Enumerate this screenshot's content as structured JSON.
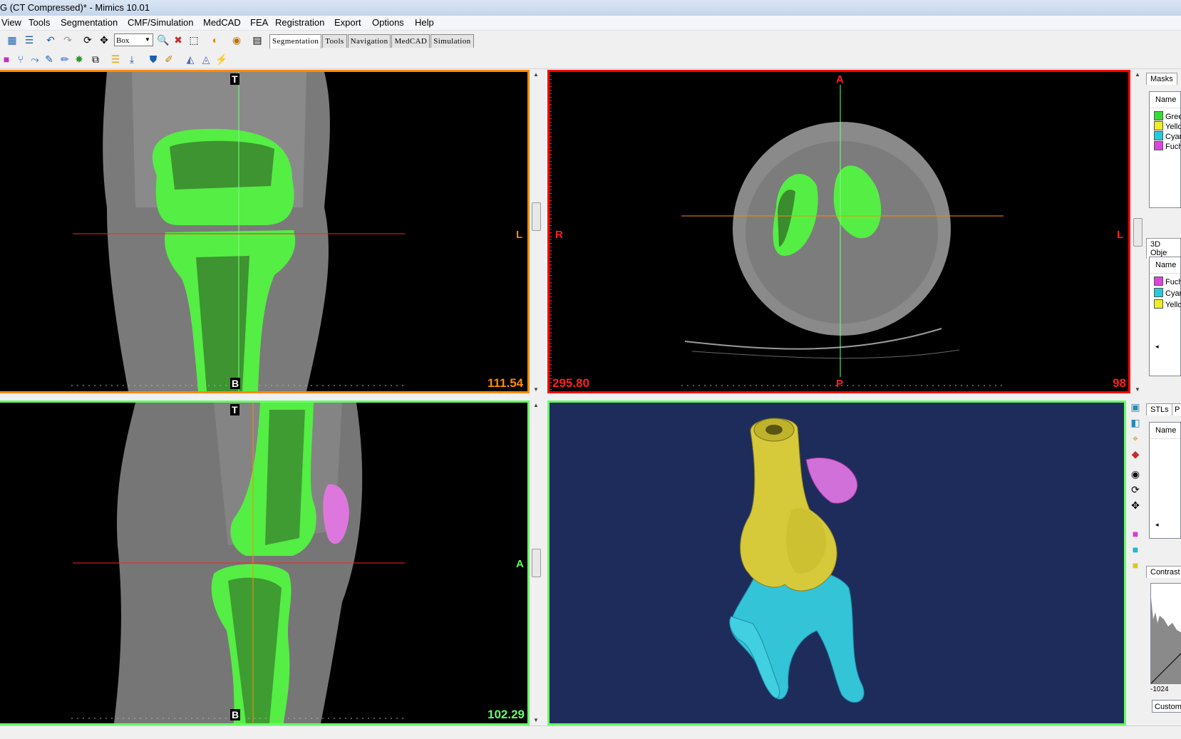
{
  "window": {
    "title": "G (CT Compressed)* - Mimics  10.01"
  },
  "menu": [
    "View",
    "Tools",
    "Segmentation",
    "CMF/Simulation",
    "MedCAD",
    "FEA",
    "Registration",
    "Export",
    "Options",
    "Help"
  ],
  "toolbar": {
    "select_value": "Box",
    "tabs": [
      "Segmentation",
      "Tools",
      "Navigation",
      "MedCAD",
      "Simulation"
    ],
    "active_tab": "Segmentation"
  },
  "views": {
    "coronal": {
      "top_label": "T",
      "bottom_label": "B",
      "right_label": "L",
      "value": "111.54",
      "accent": "#ff8a00"
    },
    "axial": {
      "top_label": "A",
      "bottom_label": "P",
      "left_label": "R",
      "right_label": "L",
      "value_left": "295.80",
      "value_right": "98",
      "accent": "#ff0000"
    },
    "sagittal": {
      "top_label": "T",
      "bottom_label": "B",
      "right_label": "A",
      "value": "102.29",
      "accent": "#66ff66"
    },
    "render3d": {
      "background": "#1e2c5c"
    }
  },
  "right_panel": {
    "masks": {
      "tab": "Masks",
      "header": "Name",
      "items": [
        {
          "name": "Gree",
          "color": "#33dd33"
        },
        {
          "name": "Yello",
          "color": "#eeee22"
        },
        {
          "name": "Cyan",
          "color": "#22ccdd"
        },
        {
          "name": "Fuch",
          "color": "#dd44dd"
        }
      ]
    },
    "objects3d": {
      "tab": "3D Obje",
      "header": "Name",
      "items": [
        {
          "name": "Fuch",
          "color": "#dd44dd"
        },
        {
          "name": "Cyan",
          "color": "#22ccdd"
        },
        {
          "name": "Yello",
          "color": "#eeee22"
        }
      ]
    },
    "stls": {
      "tab": "STLs",
      "tab2": "P",
      "header": "Name"
    },
    "contrast": {
      "tab": "Contrast",
      "min_value": "-1024",
      "preset": "Custom"
    }
  },
  "icons": {
    "toolbar1": [
      "grid-icon",
      "list-icon",
      "undo-icon",
      "redo-icon",
      "rotate-icon",
      "pan-icon",
      "zoom-in-icon",
      "zoom-out-icon",
      "zoom-fit-icon",
      "contrast-icon",
      "measure-icon",
      "layout-icon"
    ],
    "toolbar2": [
      "threshold-icon",
      "region-grow-icon",
      "edit-mask-icon",
      "pencil-icon",
      "brush-icon",
      "morphology-icon",
      "boolean-icon",
      "layers-icon",
      "fill-icon",
      "shield-icon",
      "tag-icon",
      "calc-3d-icon",
      "calc-polylines-icon",
      "wrap-icon"
    ],
    "view3d": [
      "box-view-icon",
      "front-view-icon",
      "axis-view-icon",
      "paint-icon",
      "eye-icon",
      "rotate-3d-icon",
      "pan-3d-icon",
      "fuchsia-object-icon",
      "cyan-object-icon",
      "yellow-object-icon"
    ]
  }
}
